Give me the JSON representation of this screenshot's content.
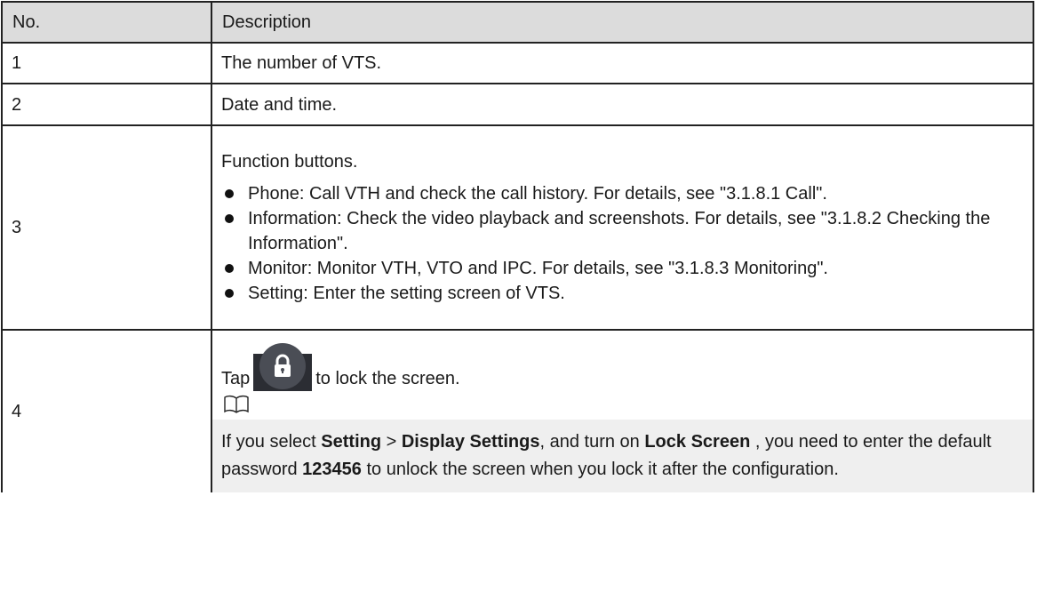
{
  "table": {
    "headers": [
      "No.",
      "Description"
    ],
    "rows": [
      {
        "no": "1",
        "description": "The number of VTS."
      },
      {
        "no": "2",
        "description": "Date and time."
      },
      {
        "no": "3",
        "intro": "Function buttons.",
        "bullets": [
          "Phone: Call VTH and check the call history. For details, see \"3.1.8.1 Call\".",
          "Information: Check the video playback and screenshots. For details, see \"3.1.8.2 Checking the Information\".",
          "Monitor: Monitor VTH, VTO and IPC. For details, see \"3.1.8.3 Monitoring\".",
          "Setting: Enter the setting screen of VTS."
        ]
      },
      {
        "no": "4",
        "tap_before": "Tap",
        "tap_after": "to lock the screen.",
        "lock_icon": "lock-icon",
        "note_icon": "book-icon",
        "note": {
          "p1": "If you select ",
          "b1": "Setting",
          "p2": " > ",
          "b2": "Display Settings",
          "p3": ", and turn on ",
          "b3": "Lock Screen",
          "p4": " , you need to enter the default password ",
          "b4": "123456",
          "p5": " to unlock the screen when you lock it after the configuration."
        }
      }
    ]
  }
}
